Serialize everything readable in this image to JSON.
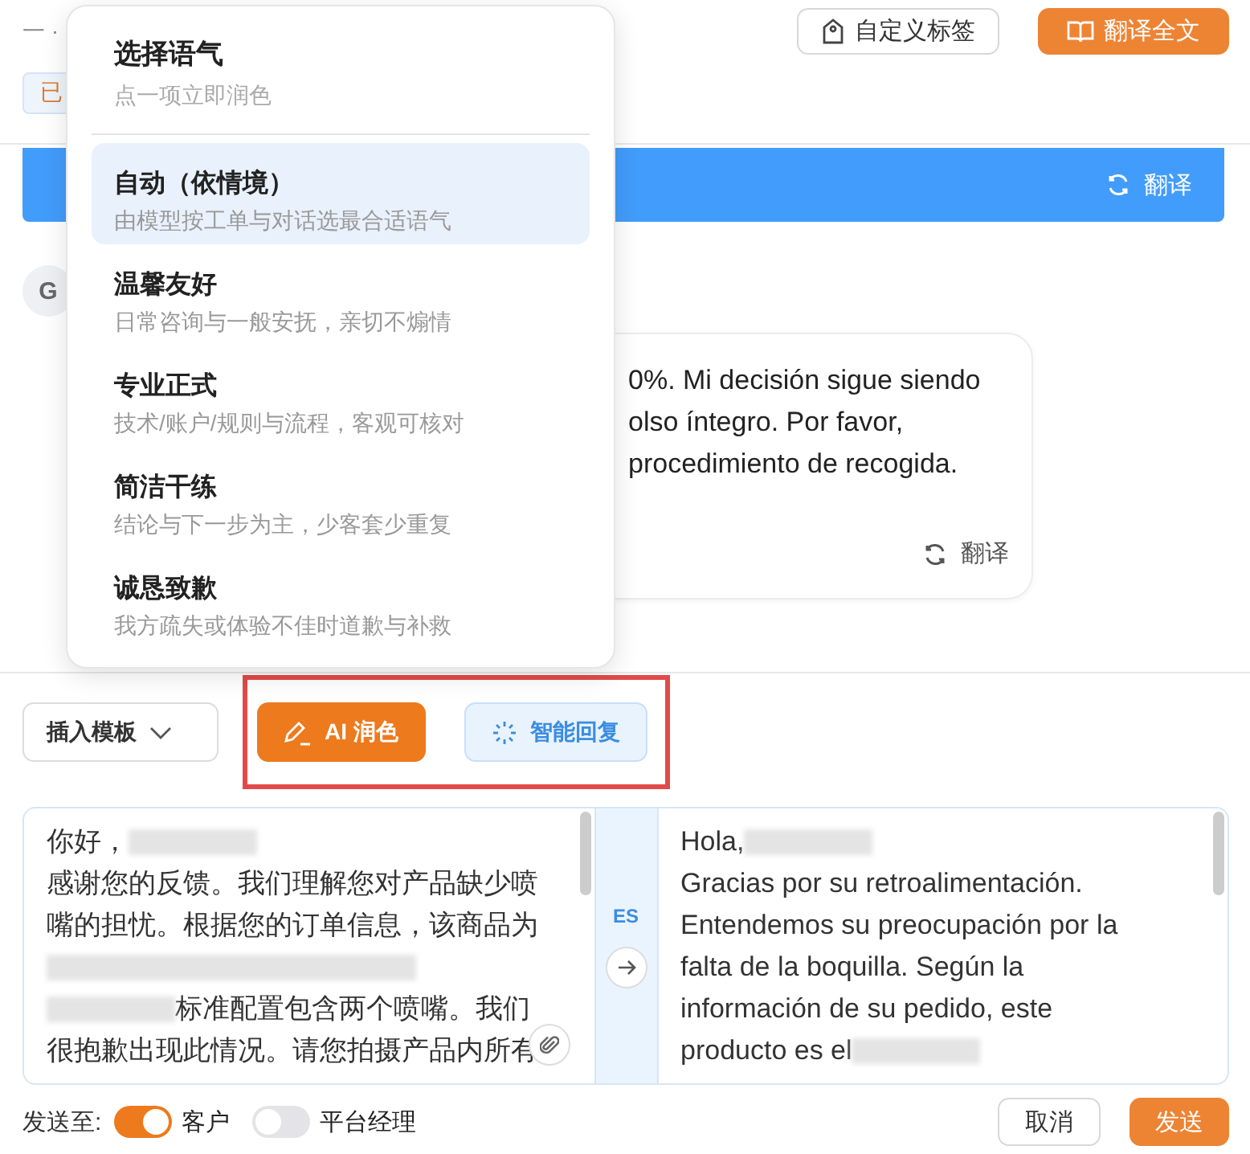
{
  "header": {
    "crumb": "一 ·",
    "tag": "已",
    "buttons": [
      {
        "kind": "outline",
        "label": "自定义标签"
      },
      {
        "kind": "primary",
        "label": "翻译全文"
      }
    ]
  },
  "chat": {
    "banner_action": "翻译",
    "avatar": "G",
    "bubble_lines": [
      "0%. Mi decisión sigue siendo",
      "olso íntegro. Por favor,",
      "procedimiento de recogida."
    ],
    "bubble_action": "翻译"
  },
  "tone_menu": {
    "title": "选择语气",
    "subtitle": "点一项立即润色",
    "options": [
      {
        "label": "自动（依情境）",
        "description": "由模型按工单与对话选最合适语气",
        "selected": true
      },
      {
        "label": "温馨友好",
        "description": "日常咨询与一般安抚，亲切不煽情",
        "selected": false
      },
      {
        "label": "专业正式",
        "description": "技术/账户/规则与流程，客观可核对",
        "selected": false
      },
      {
        "label": "简洁干练",
        "description": "结论与下一步为主，少客套少重复",
        "selected": false
      },
      {
        "label": "诚恳致歉",
        "description": "我方疏失或体验不佳时道歉与补救",
        "selected": false
      }
    ]
  },
  "toolbar": {
    "template_button": "插入模板",
    "ai_button": "AI 润色",
    "smart_reply_button": "智能回复"
  },
  "editor": {
    "language": "ES",
    "source_lines": [
      [
        {
          "kind": "text",
          "text": "你好，"
        },
        {
          "kind": "redacted"
        }
      ],
      [
        {
          "kind": "text",
          "text": "感谢您的反馈。我们理解您对产品缺少喷"
        }
      ],
      [
        {
          "kind": "text",
          "text": "嘴的担忧。根据您的订单信息，该商品为"
        }
      ],
      [
        {
          "kind": "redacted"
        }
      ],
      [
        {
          "kind": "redacted"
        },
        {
          "kind": "text",
          "text": " 标准配置包含两个喷嘴。我们"
        }
      ],
      [
        {
          "kind": "text",
          "text": "很抱歉出现此情况。请您拍摄产品内所有"
        }
      ]
    ],
    "target_lines": [
      [
        {
          "kind": "text",
          "text": "Hola,"
        },
        {
          "kind": "redacted"
        }
      ],
      [
        {
          "kind": "text",
          "text": "Gracias por su retroalimentación."
        }
      ],
      [
        {
          "kind": "text",
          "text": "Entendemos su preocupación por la"
        }
      ],
      [
        {
          "kind": "text",
          "text": "falta de la boquilla. Según la"
        }
      ],
      [
        {
          "kind": "text",
          "text": "información de su pedido, este"
        }
      ],
      [
        {
          "kind": "text",
          "text": "producto es el "
        },
        {
          "kind": "redacted"
        }
      ]
    ]
  },
  "footer": {
    "send_to": "发送至:",
    "recipients": [
      {
        "label": "客户",
        "on": true
      },
      {
        "label": "平台经理",
        "on": false
      }
    ],
    "cancel": "取消",
    "send": "发送"
  }
}
